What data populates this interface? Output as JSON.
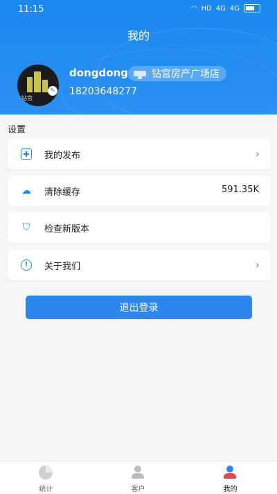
{
  "status_bar": {
    "time": "11:15",
    "network": "HD",
    "signal1": "4G",
    "signal2": "4G"
  },
  "header": {
    "title": "我的",
    "username": "dongdong",
    "store_name": "钻宫房产广场店",
    "phone": "18203648277",
    "avatar_text": "钻宫"
  },
  "settings": {
    "section_title": "设置",
    "items": [
      {
        "label": "我的发布",
        "value": "",
        "icon": "add-square-icon",
        "chevron": "›"
      },
      {
        "label": "清除缓存",
        "value": "591.35K",
        "icon": "cloud-icon",
        "chevron": ""
      },
      {
        "label": "检查新版本",
        "value": "",
        "icon": "shield-icon",
        "chevron": ""
      },
      {
        "label": "关于我们",
        "value": "",
        "icon": "info-icon",
        "chevron": "›"
      }
    ]
  },
  "logout_label": "退出登录",
  "tabs": [
    {
      "label": "统计",
      "icon": "pie-chart-icon"
    },
    {
      "label": "客户",
      "icon": "customer-icon"
    },
    {
      "label": "我的",
      "icon": "profile-icon",
      "active": true
    }
  ],
  "colors": {
    "accent": "#1a88f0",
    "button": "#2d86ef",
    "background": "#f5f6f8"
  }
}
